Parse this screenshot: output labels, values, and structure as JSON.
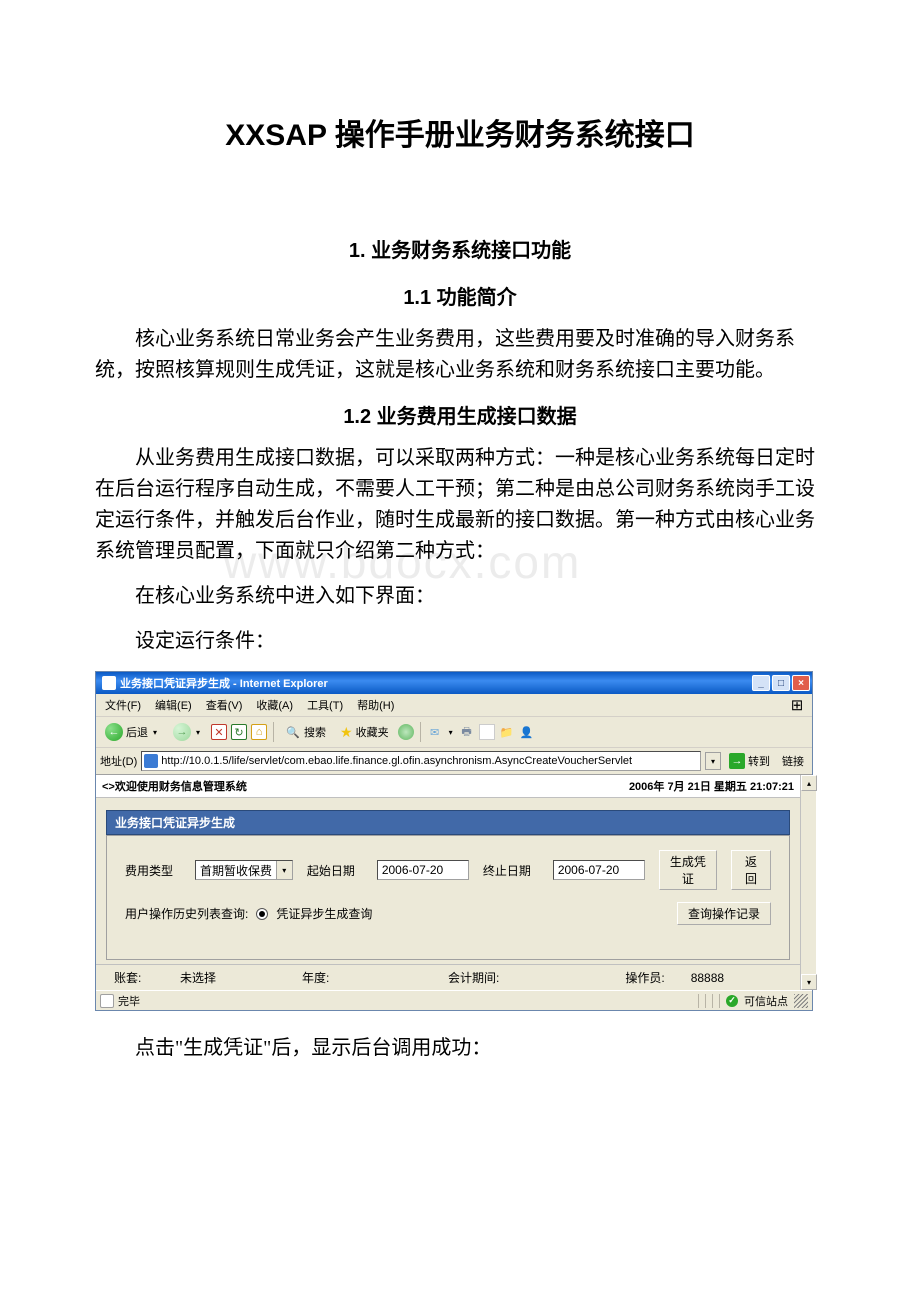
{
  "doc": {
    "title": "XXSAP 操作手册业务财务系统接口",
    "section1_title": "1. 业务财务系统接口功能",
    "section11_title": "1.1 功能简介",
    "para11": "核心业务系统日常业务会产生业务费用，这些费用要及时准确的导入财务系统，按照核算规则生成凭证，这就是核心业务系统和财务系统接口主要功能。",
    "section12_title": "1.2 业务费用生成接口数据",
    "para12a": "从业务费用生成接口数据，可以采取两种方式：一种是核心业务系统每日定时在后台运行程序自动生成，不需要人工干预；第二种是由总公司财务系统岗手工设定运行条件，并触发后台作业，随时生成最新的接口数据。第一种方式由核心业务系统管理员配置，下面就只介绍第二种方式：",
    "para12b": "在核心业务系统中进入如下界面：",
    "para12c": "设定运行条件：",
    "para_after": "点击\"生成凭证\"后，显示后台调用成功："
  },
  "watermark": "www.bdocx.com",
  "ie": {
    "title": "业务接口凭证异步生成 - Internet Explorer",
    "menu": {
      "file": "文件(F)",
      "edit": "编辑(E)",
      "view": "查看(V)",
      "fav": "收藏(A)",
      "tools": "工具(T)",
      "help": "帮助(H)"
    },
    "toolbar": {
      "back": "后退",
      "search": "搜索",
      "favorites": "收藏夹"
    },
    "addr": {
      "label": "地址(D)",
      "url": "http://10.0.1.5/life/servlet/com.ebao.life.finance.gl.ofin.asynchronism.AsyncCreateVoucherServlet",
      "go": "转到",
      "links": "链接"
    },
    "content": {
      "welcome": "<>欢迎使用财务信息管理系统",
      "datetime": "2006年 7月 21日 星期五 21:07:21",
      "panel_title": "业务接口凭证异步生成",
      "form": {
        "fee_type_label": "费用类型",
        "fee_type_value": "首期暂收保费",
        "start_label": "起始日期",
        "start_value": "2006-07-20",
        "end_label": "终止日期",
        "end_value": "2006-07-20",
        "btn_generate": "生成凭证",
        "btn_back": "返回",
        "history_label": "用户操作历史列表查询:",
        "radio1": "凭证异步生成查询",
        "btn_query": "查询操作记录"
      },
      "footer": {
        "account_label": "账套:",
        "account_value": "未选择",
        "year_label": "年度:",
        "period_label": "会计期间:",
        "operator_label": "操作员:",
        "operator_value": "88888"
      }
    },
    "status": {
      "done": "完毕",
      "trusted": "可信站点"
    }
  }
}
